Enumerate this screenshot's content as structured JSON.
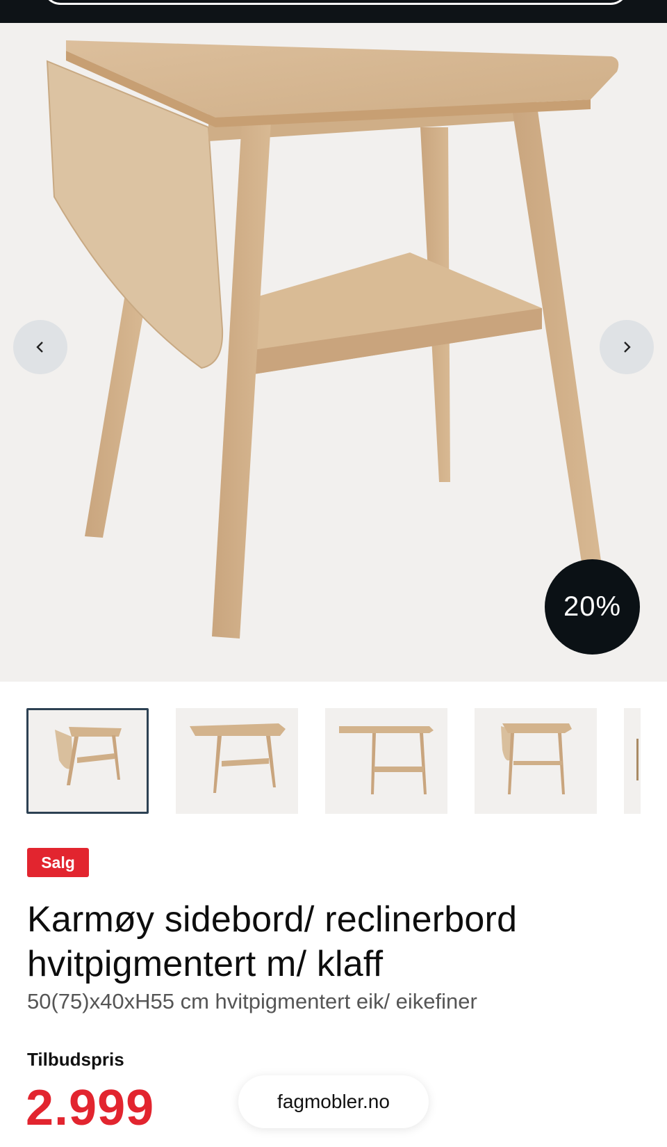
{
  "gallery": {
    "discount_badge": "20%",
    "prev_icon": "chevron-left-icon",
    "next_icon": "chevron-right-icon",
    "thumbnail_count_visible": 5,
    "active_thumbnail": 1
  },
  "product": {
    "sale_label": "Salg",
    "title": "Karmøy sidebord/ reclinerbord hvitpigmentert m/ klaff",
    "subtitle": "50(75)x40xH55 cm hvitpigmentert eik/ eikefiner",
    "price_label": "Tilbudspris",
    "price": "2.999"
  },
  "browser": {
    "domain": "fagmobler.no"
  },
  "colors": {
    "accent_red": "#e2252f",
    "badge_dark": "#0b1115",
    "image_background": "#f2f0ee",
    "active_thumb_border": "#2d4153"
  }
}
